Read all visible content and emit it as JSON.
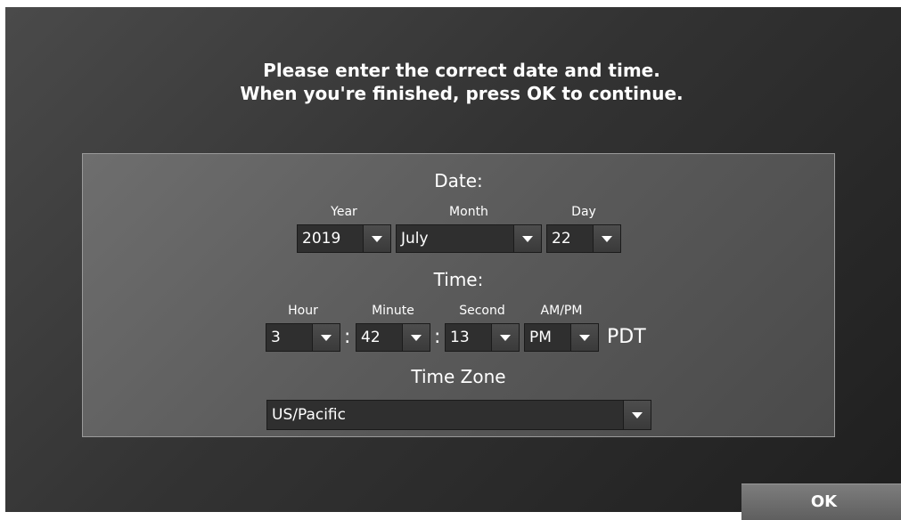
{
  "instructions": {
    "line1": "Please enter the correct date and time.",
    "line2": "When you're finished, press OK to continue."
  },
  "date": {
    "title": "Date:",
    "year": {
      "label": "Year",
      "value": "2019"
    },
    "month": {
      "label": "Month",
      "value": "July"
    },
    "day": {
      "label": "Day",
      "value": "22"
    }
  },
  "time": {
    "title": "Time:",
    "hour": {
      "label": "Hour",
      "value": "3"
    },
    "minute": {
      "label": "Minute",
      "value": "42"
    },
    "second": {
      "label": "Second",
      "value": "13"
    },
    "ampm": {
      "label": "AM/PM",
      "value": "PM"
    },
    "separator": ":",
    "zone_abbr": "PDT"
  },
  "timezone": {
    "title": "Time Zone",
    "value": "US/Pacific"
  },
  "ok_label": "OK",
  "icons": {
    "dropdown": "chevron-down-icon"
  },
  "colors": {
    "background": "#333333",
    "panel": "#5e5e5e",
    "select": "#2f2f2f",
    "ok_button": "#6e6e6e",
    "text": "#ffffff"
  }
}
